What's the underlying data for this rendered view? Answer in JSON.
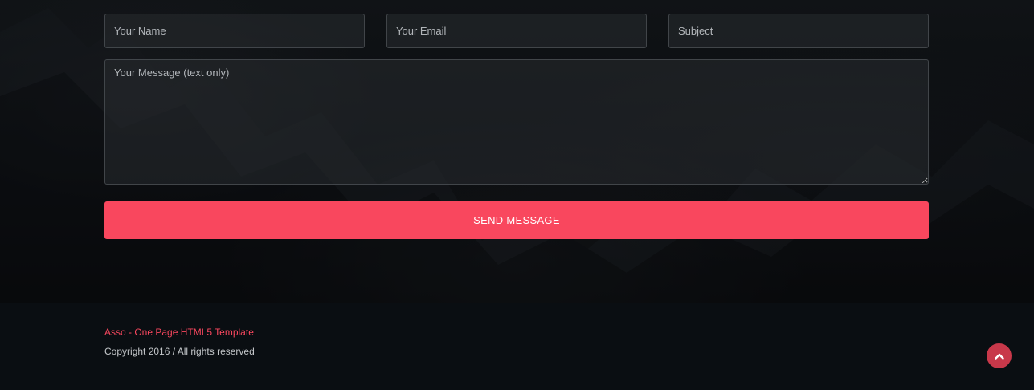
{
  "contact_form": {
    "name_placeholder": "Your Name",
    "email_placeholder": "Your Email",
    "subject_placeholder": "Subject",
    "message_placeholder": "Your Message (text only)",
    "send_label": "SEND MESSAGE"
  },
  "footer": {
    "title": "Asso - One Page HTML5 Template",
    "copyright": "Copyright 2016 / All rights reserved"
  },
  "icons": {
    "scroll_top": "chevron-up-icon"
  },
  "colors": {
    "accent": "#f9475e",
    "scroll_top_bg": "#c8384a",
    "footer_bg": "#0a0e12"
  }
}
